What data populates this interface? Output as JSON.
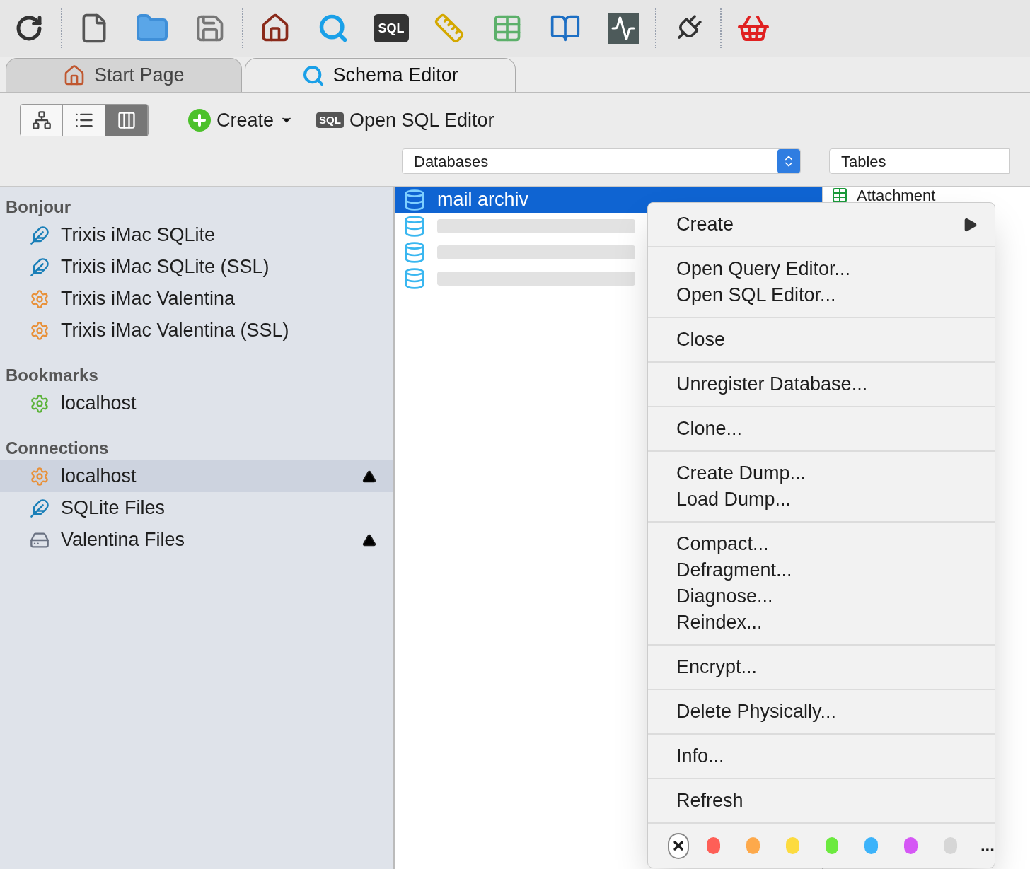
{
  "toolbar": {
    "sql_icon_label": "SQL"
  },
  "tabs": [
    {
      "label": "Start Page",
      "selected": false,
      "kind": "home"
    },
    {
      "label": "Schema Editor",
      "selected": true,
      "kind": "schema"
    }
  ],
  "view_modes": [
    {
      "kind": "diagram",
      "selected": false
    },
    {
      "kind": "list",
      "selected": false
    },
    {
      "kind": "columns",
      "selected": true
    }
  ],
  "actions": {
    "create": "Create",
    "sql_badge": "SQL",
    "open_sql": "Open SQL Editor"
  },
  "selectors": {
    "databases": "Databases",
    "tables": "Tables"
  },
  "sidebar": [
    {
      "title": "Bonjour",
      "items": [
        {
          "label": "Trixis iMac SQLite",
          "kind": "sqlite",
          "selected": false,
          "eject": false
        },
        {
          "label": "Trixis iMac SQLite (SSL)",
          "kind": "sqlite",
          "selected": false,
          "eject": false
        },
        {
          "label": "Trixis iMac Valentina",
          "kind": "valentina",
          "selected": false,
          "eject": false
        },
        {
          "label": "Trixis iMac Valentina (SSL)",
          "kind": "valentina",
          "selected": false,
          "eject": false
        }
      ]
    },
    {
      "title": "Bookmarks",
      "items": [
        {
          "label": "localhost",
          "kind": "bookmark",
          "selected": false,
          "eject": false
        }
      ]
    },
    {
      "title": "Connections",
      "items": [
        {
          "label": "localhost",
          "kind": "valentina",
          "selected": true,
          "eject": true
        },
        {
          "label": "SQLite Files",
          "kind": "sqlite",
          "selected": false,
          "eject": false
        },
        {
          "label": "Valentina Files",
          "kind": "drive",
          "selected": false,
          "eject": true
        }
      ]
    }
  ],
  "databases": [
    {
      "label": "mail archiv",
      "selected": true,
      "blurred": false
    },
    {
      "selected": false,
      "blurred": true
    },
    {
      "selected": false,
      "blurred": true
    },
    {
      "selected": false,
      "blurred": true
    }
  ],
  "tables": [
    {
      "label": "Attachment"
    }
  ],
  "context_menu": {
    "groups": [
      [
        {
          "label": "Create",
          "submenu": true
        }
      ],
      [
        {
          "label": "Open Query Editor...",
          "submenu": false
        },
        {
          "label": "Open SQL Editor...",
          "submenu": false
        }
      ],
      [
        {
          "label": "Close",
          "submenu": false
        }
      ],
      [
        {
          "label": "Unregister Database...",
          "submenu": false
        }
      ],
      [
        {
          "label": "Clone...",
          "submenu": false
        }
      ],
      [
        {
          "label": "Create Dump...",
          "submenu": false
        },
        {
          "label": "Load Dump...",
          "submenu": false
        }
      ],
      [
        {
          "label": "Compact...",
          "submenu": false
        },
        {
          "label": "Defragment...",
          "submenu": false
        },
        {
          "label": "Diagnose...",
          "submenu": false
        },
        {
          "label": "Reindex...",
          "submenu": false
        }
      ],
      [
        {
          "label": "Encrypt...",
          "submenu": false
        }
      ],
      [
        {
          "label": "Delete Physically...",
          "submenu": false
        }
      ],
      [
        {
          "label": "Info...",
          "submenu": false
        }
      ],
      [
        {
          "label": "Refresh",
          "submenu": false
        }
      ]
    ],
    "colors": [
      {
        "kind": "none"
      },
      {
        "kind": "color",
        "color": "#fe5f57"
      },
      {
        "kind": "color",
        "color": "#fda94b"
      },
      {
        "kind": "color",
        "color": "#fcdb3f"
      },
      {
        "kind": "color",
        "color": "#6cea3f"
      },
      {
        "kind": "color",
        "color": "#3cb3fa"
      },
      {
        "kind": "color",
        "color": "#d557f5"
      },
      {
        "kind": "color",
        "color": "#d6d6d6"
      }
    ],
    "more": "..."
  }
}
